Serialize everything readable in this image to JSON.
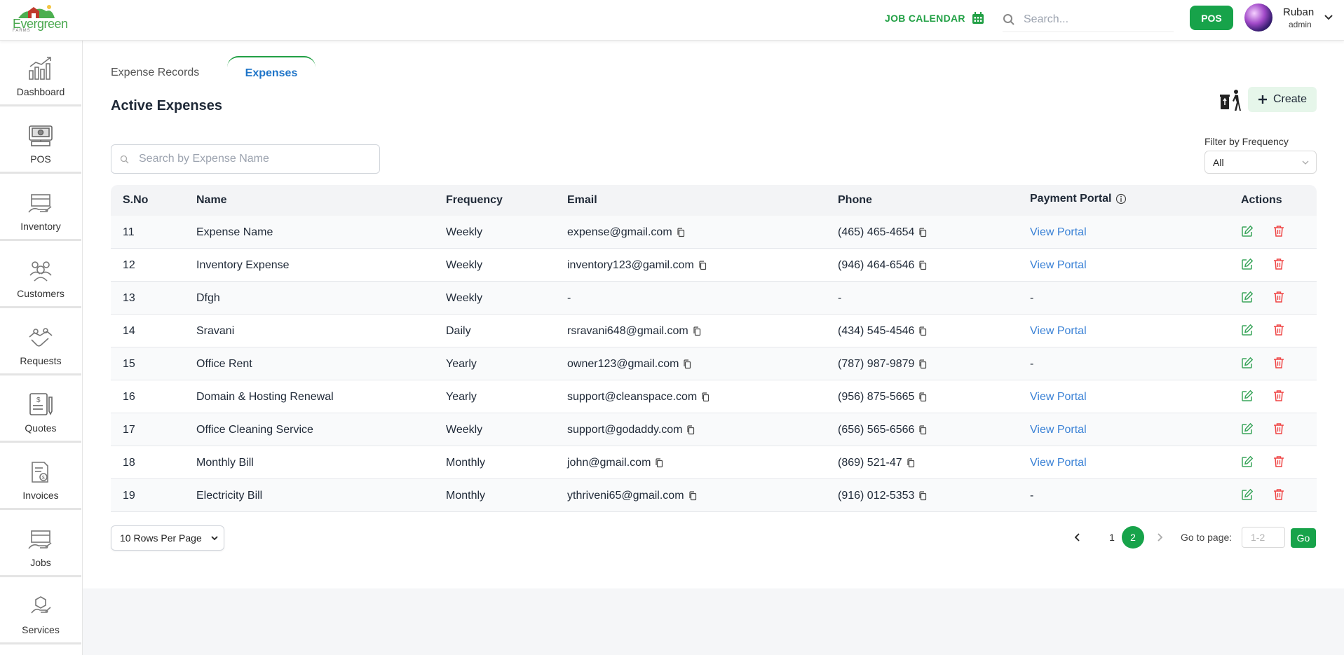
{
  "header": {
    "logo_text": "Evergreen",
    "logo_sub": "FARMS",
    "job_calendar": "JOB CALENDAR",
    "search_placeholder": "Search...",
    "pos_label": "POS",
    "user_name": "Ruban",
    "user_role": "admin"
  },
  "sidebar": {
    "items": [
      {
        "label": "Dashboard",
        "icon": "chart-icon"
      },
      {
        "label": "POS",
        "icon": "pos-terminal-icon"
      },
      {
        "label": "Inventory",
        "icon": "inventory-icon"
      },
      {
        "label": "Customers",
        "icon": "customers-icon"
      },
      {
        "label": "Requests",
        "icon": "requests-icon"
      },
      {
        "label": "Quotes",
        "icon": "quotes-icon"
      },
      {
        "label": "Invoices",
        "icon": "invoices-icon"
      },
      {
        "label": "Jobs",
        "icon": "jobs-icon"
      },
      {
        "label": "Services",
        "icon": "services-icon"
      }
    ]
  },
  "tabs": {
    "records": "Expense Records",
    "expenses": "Expenses"
  },
  "page": {
    "title": "Active Expenses",
    "create_label": "Create",
    "search_placeholder": "Search by Expense Name",
    "filter_label": "Filter by Frequency",
    "filter_value": "All"
  },
  "table": {
    "headers": {
      "sno": "S.No",
      "name": "Name",
      "frequency": "Frequency",
      "email": "Email",
      "phone": "Phone",
      "portal": "Payment Portal",
      "actions": "Actions"
    },
    "rows": [
      {
        "sno": "11",
        "name": "Expense Name",
        "frequency": "Weekly",
        "email": "expense@gmail.com",
        "phone": "(465) 465-4654",
        "portal": "View Portal"
      },
      {
        "sno": "12",
        "name": "Inventory Expense",
        "frequency": "Weekly",
        "email": "inventory123@gamil.com",
        "phone": "(946) 464-6546",
        "portal": "View Portal"
      },
      {
        "sno": "13",
        "name": "Dfgh",
        "frequency": "Weekly",
        "email": "-",
        "phone": "-",
        "portal": "-"
      },
      {
        "sno": "14",
        "name": "Sravani",
        "frequency": "Daily",
        "email": "rsravani648@gmail.com",
        "phone": "(434) 545-4546",
        "portal": "View Portal"
      },
      {
        "sno": "15",
        "name": "Office Rent",
        "frequency": "Yearly",
        "email": "owner123@gmail.com",
        "phone": "(787) 987-9879",
        "portal": "-"
      },
      {
        "sno": "16",
        "name": "Domain & Hosting Renewal",
        "frequency": "Yearly",
        "email": "support@cleanspace.com",
        "phone": "(956) 875-5665",
        "portal": "View Portal"
      },
      {
        "sno": "17",
        "name": "Office Cleaning Service",
        "frequency": "Weekly",
        "email": "support@godaddy.com",
        "phone": "(656) 565-6566",
        "portal": "View Portal"
      },
      {
        "sno": "18",
        "name": "Monthly Bill",
        "frequency": "Monthly",
        "email": "john@gmail.com",
        "phone": "(869) 521-47",
        "portal": "View Portal"
      },
      {
        "sno": "19",
        "name": "Electricity Bill",
        "frequency": "Monthly",
        "email": "ythriveni65@gmail.com",
        "phone": "(916) 012-5353",
        "portal": "-"
      }
    ]
  },
  "pagination": {
    "rows_per_page": "10 Rows Per Page",
    "pages": [
      "1",
      "2"
    ],
    "current_page": "2",
    "goto_label": "Go to page:",
    "goto_placeholder": "1-2",
    "go_label": "Go"
  },
  "colors": {
    "brand_green": "#17a34a",
    "link_blue": "#3b82d6",
    "delete_red": "#ef4444"
  }
}
